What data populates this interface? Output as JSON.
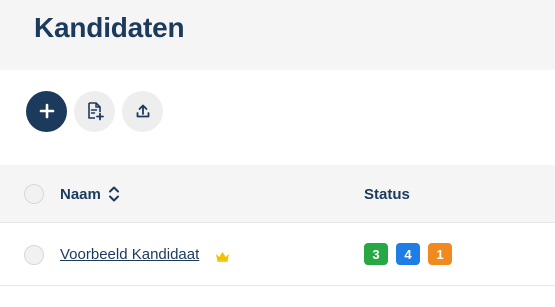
{
  "page": {
    "title": "Kandidaten"
  },
  "toolbar": {
    "buttons": [
      {
        "icon": "plus-icon"
      },
      {
        "icon": "document-add-icon"
      },
      {
        "icon": "upload-icon"
      }
    ]
  },
  "table": {
    "columns": {
      "name": "Naam",
      "status": "Status"
    },
    "rows": [
      {
        "name": "Voorbeeld Kandidaat",
        "crown": "crown-icon",
        "badges": [
          {
            "value": "3",
            "color": "#28a745"
          },
          {
            "value": "4",
            "color": "#1e7ee6"
          },
          {
            "value": "1",
            "color": "#f0891e"
          }
        ]
      }
    ]
  },
  "colors": {
    "primary": "#1b3a5c",
    "crown": "#f2c200"
  }
}
